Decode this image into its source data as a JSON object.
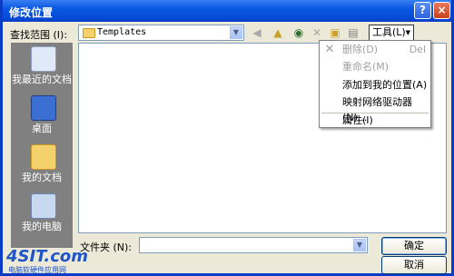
{
  "window": {
    "title": "修改位置"
  },
  "lookin": {
    "label": "查找范围 (I):",
    "value": "Templates"
  },
  "toolbar": {
    "tools_label": "工具(L)"
  },
  "places": [
    {
      "label": "我最近的文档",
      "icon": "recent-docs-icon"
    },
    {
      "label": "桌面",
      "icon": "desktop-icon"
    },
    {
      "label": "我的文档",
      "icon": "my-documents-icon"
    },
    {
      "label": "我的电脑",
      "icon": "my-computer-icon"
    }
  ],
  "menu": {
    "items": [
      {
        "label": "删除(D)",
        "shortcut": "Del",
        "disabled": true
      },
      {
        "label": "重命名(M)",
        "shortcut": "",
        "disabled": true
      },
      {
        "label": "添加到我的位置(A)",
        "shortcut": "",
        "disabled": false
      },
      {
        "label": "映射网络驱动器(N)...",
        "shortcut": "",
        "disabled": false
      },
      {
        "label": "属性(I)",
        "shortcut": "",
        "disabled": false
      }
    ]
  },
  "filename": {
    "label": "文件夹 (N):",
    "value": ""
  },
  "buttons": {
    "ok": "确定",
    "cancel": "取消"
  },
  "watermark": {
    "logo": "4SIT.com",
    "sub": "电脑软硬件应用网"
  }
}
